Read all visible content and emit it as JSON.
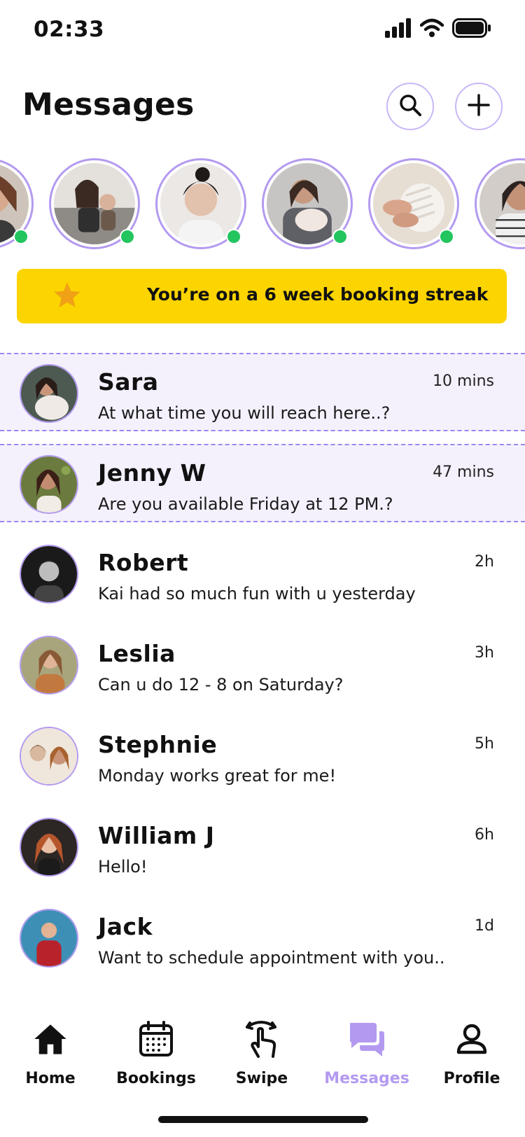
{
  "status_bar": {
    "time": "02:33"
  },
  "header": {
    "title": "Messages"
  },
  "stories": [
    {
      "online": true,
      "tone": "#7a5a4a"
    },
    {
      "online": true,
      "tone": "#8b7d70"
    },
    {
      "online": true,
      "tone": "#d9c9bf"
    },
    {
      "online": true,
      "tone": "#8c8a88"
    },
    {
      "online": true,
      "tone": "#d8c7b4"
    },
    {
      "online": false,
      "tone": "#8d7a6b"
    }
  ],
  "streak": {
    "text": "You’re on a 6 week booking streak"
  },
  "conversations": [
    {
      "name": "Sara",
      "preview": "At what time you will reach here..?",
      "time": "10 mins",
      "unread": true
    },
    {
      "name": "Jenny W",
      "preview": "Are you available Friday at 12 PM.?",
      "time": "47 mins",
      "unread": true
    },
    {
      "name": "Robert",
      "preview": "Kai had so much fun with u yesterday",
      "time": "2h",
      "unread": false
    },
    {
      "name": "Leslia",
      "preview": "Can u do 12 - 8 on Saturday?",
      "time": "3h",
      "unread": false
    },
    {
      "name": "Stephnie",
      "preview": "Monday works great for me!",
      "time": "5h",
      "unread": false
    },
    {
      "name": "William J",
      "preview": "Hello!",
      "time": "6h",
      "unread": false
    },
    {
      "name": "Jack",
      "preview": "Want to schedule appointment with you..",
      "time": "1d",
      "unread": false
    }
  ],
  "nav": {
    "home": "Home",
    "bookings": "Bookings",
    "swipe": "Swipe",
    "messages": "Messages",
    "profile": "Profile",
    "active": "messages"
  },
  "colors": {
    "accent": "#b39af0",
    "streak_bg": "#fcd400",
    "online": "#22c55e",
    "unread_bg": "#f4f1fd"
  }
}
